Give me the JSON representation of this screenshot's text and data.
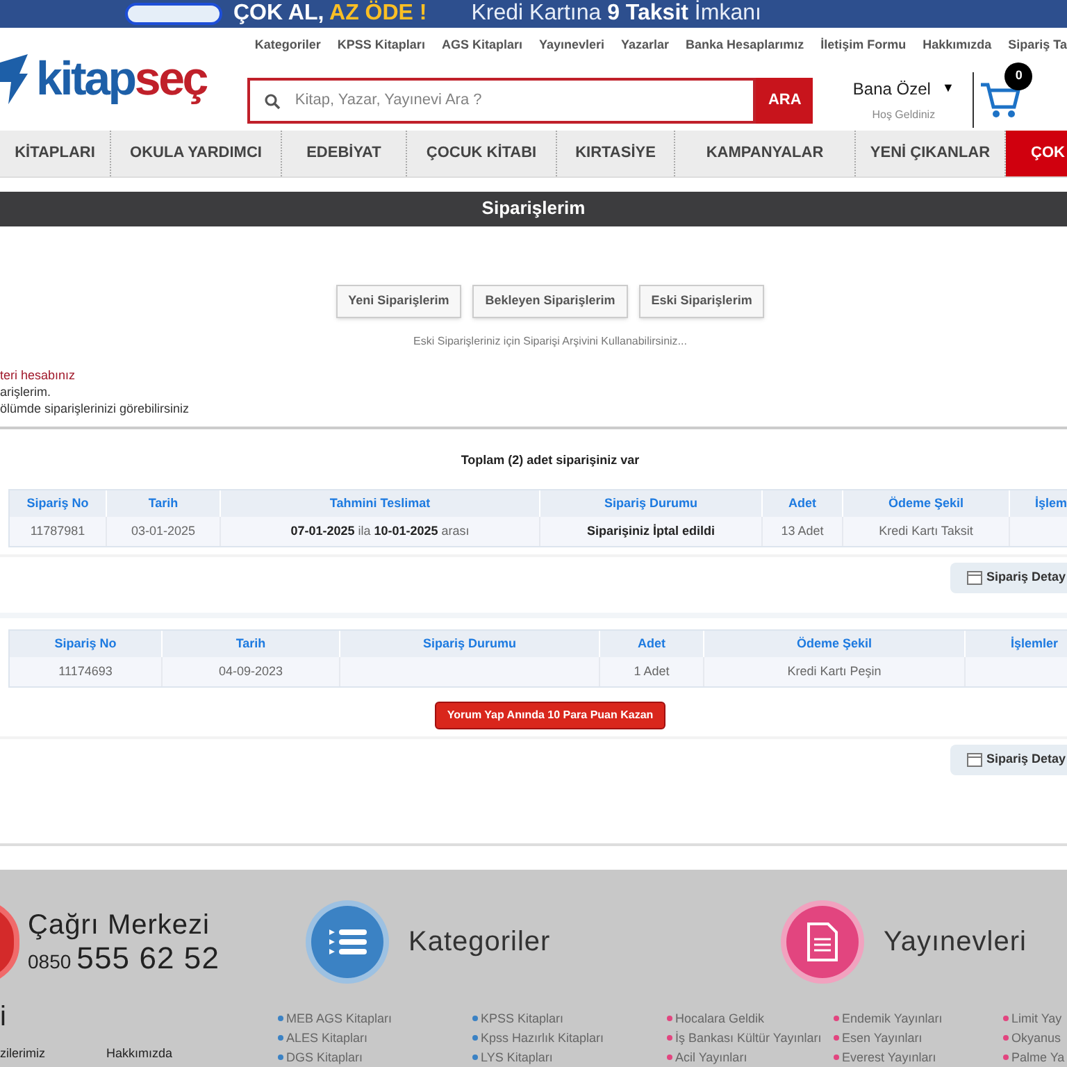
{
  "banner": {
    "text_1": "ÇOK AL,",
    "text_2": "AZ ÖDE !",
    "text_3": "Kredi Kartına",
    "text_4": "9 Taksit",
    "text_5": "İmkanı"
  },
  "header": {
    "logo_1": "kitap",
    "logo_2": "seç",
    "top_links": [
      "Kategoriler",
      "KPSS Kitapları",
      "AGS Kitapları",
      "Yayınevleri",
      "Yazarlar",
      "Banka Hesaplarımız",
      "İletişim Formu",
      "Hakkımızda",
      "Sipariş Ta"
    ],
    "search": {
      "placeholder": "Kitap, Yazar, Yayınevi Ara ?",
      "button": "ARA"
    },
    "user": {
      "label": "Bana Özel",
      "caret": "▼",
      "greeting": "Hoş Geldiniz"
    },
    "cart_count": "0"
  },
  "nav": [
    {
      "label": "KİTAPLARI",
      "kind": "normal"
    },
    {
      "label": "OKULA YARDIMCI",
      "kind": "normal"
    },
    {
      "label": "EDEBİYAT",
      "kind": "normal"
    },
    {
      "label": "ÇOCUK KİTABI",
      "kind": "normal"
    },
    {
      "label": "KIRTASİYE",
      "kind": "normal"
    },
    {
      "label": "KAMPANYALAR",
      "kind": "normal"
    },
    {
      "label": "YENİ ÇIKANLAR",
      "kind": "normal"
    },
    {
      "label": "ÇOK",
      "kind": "highlight"
    }
  ],
  "page_title": "Siparişlerim",
  "order_tabs": [
    "Yeni Siparişlerim",
    "Bekleyen Siparişlerim",
    "Eski Siparişlerim"
  ],
  "archive_note": "Eski Siparişleriniz için Siparişi Arşivini Kullanabilirsiniz...",
  "side_text": [
    {
      "text": "teri hesabınız",
      "kind": "alert"
    },
    {
      "text": "arişlerim.",
      "kind": "plain"
    },
    {
      "text": "ölümde siparişlerinizi görebilirsiniz",
      "kind": "plain"
    }
  ],
  "summary": "Toplam (2) adet siparişiniz var",
  "orders": [
    {
      "columns": [
        "Sipariş No",
        "Tarih",
        "Tahmini Teslimat",
        "Sipariş Durumu",
        "Adet",
        "Ödeme Şekil",
        "İşlem"
      ],
      "row": {
        "cell_1": "11787981",
        "cell_2": "03-01-2025",
        "cell_3": "**07-01-2025** ila **10-01-2025** arası",
        "cell_4": "**Siparişiniz İptal edildi**",
        "cell_5": "13 Adet",
        "cell_6": "Kredi Kartı Taksit"
      },
      "detail_button": "Sipariş Detay"
    },
    {
      "columns": [
        "Sipariş No",
        "Tarih",
        "Sipariş Durumu",
        "Adet",
        "Ödeme Şekil",
        "İşlemler"
      ],
      "row": {
        "cell_1": "11174693",
        "cell_2": "04-09-2023",
        "cell_4": "1 Adet",
        "cell_5": "Kredi Kartı Peşin"
      },
      "review_button": "Yorum Yap Anında 10 Para Puan Kazan",
      "detail_button": "Sipariş Detay"
    }
  ],
  "footer": {
    "call_center": {
      "title": "Çağrı Merkezi",
      "prefix": "0850",
      "number": "555 62 52"
    },
    "categories": {
      "title": "Kategoriler",
      "color": "#3b82c4",
      "columns": [
        [
          "MEB AGS Kitapları",
          "ALES Kitapları",
          "DGS Kitapları"
        ],
        [
          "KPSS Kitapları",
          "Kpss Hazırlık Kitapları",
          "LYS Kitapları"
        ]
      ]
    },
    "publishers": {
      "title": "Yayınevleri",
      "color": "#e2457f",
      "columns": [
        [
          "Hocalara Geldik",
          "İş Bankası Kültür Yayınları",
          "Acil Yayınları"
        ],
        [
          "Endemik Yayınları",
          "Esen Yayınları",
          "Everest Yayınları"
        ],
        [
          "Limit Yay",
          "Okyanus",
          "Palme Ya"
        ]
      ]
    },
    "left_heading": "i",
    "left_links": [
      "zilerimiz",
      "Hakkımızda"
    ]
  }
}
